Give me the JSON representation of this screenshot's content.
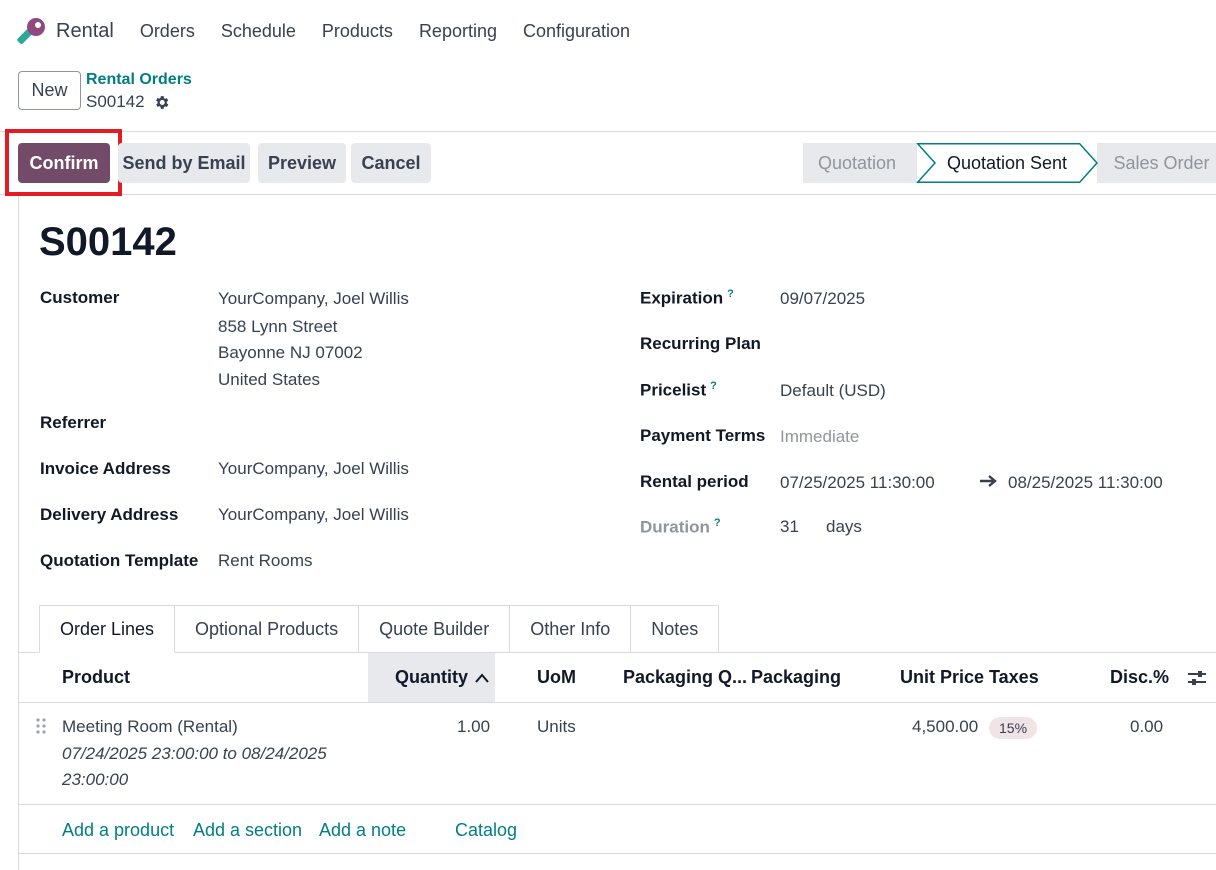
{
  "app": {
    "name": "Rental",
    "accent": "#714b67",
    "link_color": "#017e84",
    "icon": "rental-key-icon"
  },
  "nav": [
    "Orders",
    "Schedule",
    "Products",
    "Reporting",
    "Configuration"
  ],
  "breadcrumb": {
    "new_label": "New",
    "parent": "Rental Orders",
    "current": "S00142"
  },
  "actions": {
    "confirm": "Confirm",
    "send_email": "Send by Email",
    "preview": "Preview",
    "cancel": "Cancel"
  },
  "status": {
    "stages": [
      "Quotation",
      "Quotation Sent",
      "Sales Order"
    ],
    "current": "Quotation Sent"
  },
  "order": {
    "name": "S00142",
    "customer_label": "Customer",
    "customer_lines": [
      "YourCompany, Joel Willis",
      "858 Lynn Street",
      "Bayonne NJ 07002",
      "United States"
    ],
    "referrer_label": "Referrer",
    "invoice_label": "Invoice Address",
    "invoice_value": "YourCompany, Joel Willis",
    "delivery_label": "Delivery Address",
    "delivery_value": "YourCompany, Joel Willis",
    "template_label": "Quotation Template",
    "template_value": "Rent Rooms",
    "expiration_label": "Expiration",
    "expiration_value": "09/07/2025",
    "recurring_label": "Recurring Plan",
    "pricelist_label": "Pricelist",
    "pricelist_value": "Default (USD)",
    "terms_label": "Payment Terms",
    "terms_placeholder": "Immediate",
    "rental_label": "Rental period",
    "rental_start": "07/25/2025 11:30:00",
    "rental_end": "08/25/2025 11:30:00",
    "duration_label": "Duration",
    "duration_value": "31",
    "duration_unit": "days"
  },
  "tabs": [
    "Order Lines",
    "Optional Products",
    "Quote Builder",
    "Other Info",
    "Notes"
  ],
  "table": {
    "columns": {
      "product": "Product",
      "quantity": "Quantity",
      "uom": "UoM",
      "packaging_qty": "Packaging Q...",
      "packaging": "Packaging",
      "unit_price": "Unit Price",
      "taxes": "Taxes",
      "discount": "Disc.%"
    },
    "rows": [
      {
        "product": "Meeting Room (Rental)",
        "desc_line1": "07/24/2025 23:00:00 to 08/24/2025",
        "desc_line2": "23:00:00",
        "quantity": "1.00",
        "uom": "Units",
        "unit_price": "4,500.00",
        "tax": "15%",
        "discount": "0.00"
      }
    ],
    "footer_links": {
      "add_product": "Add a product",
      "add_section": "Add a section",
      "add_note": "Add a note",
      "catalog": "Catalog"
    }
  }
}
